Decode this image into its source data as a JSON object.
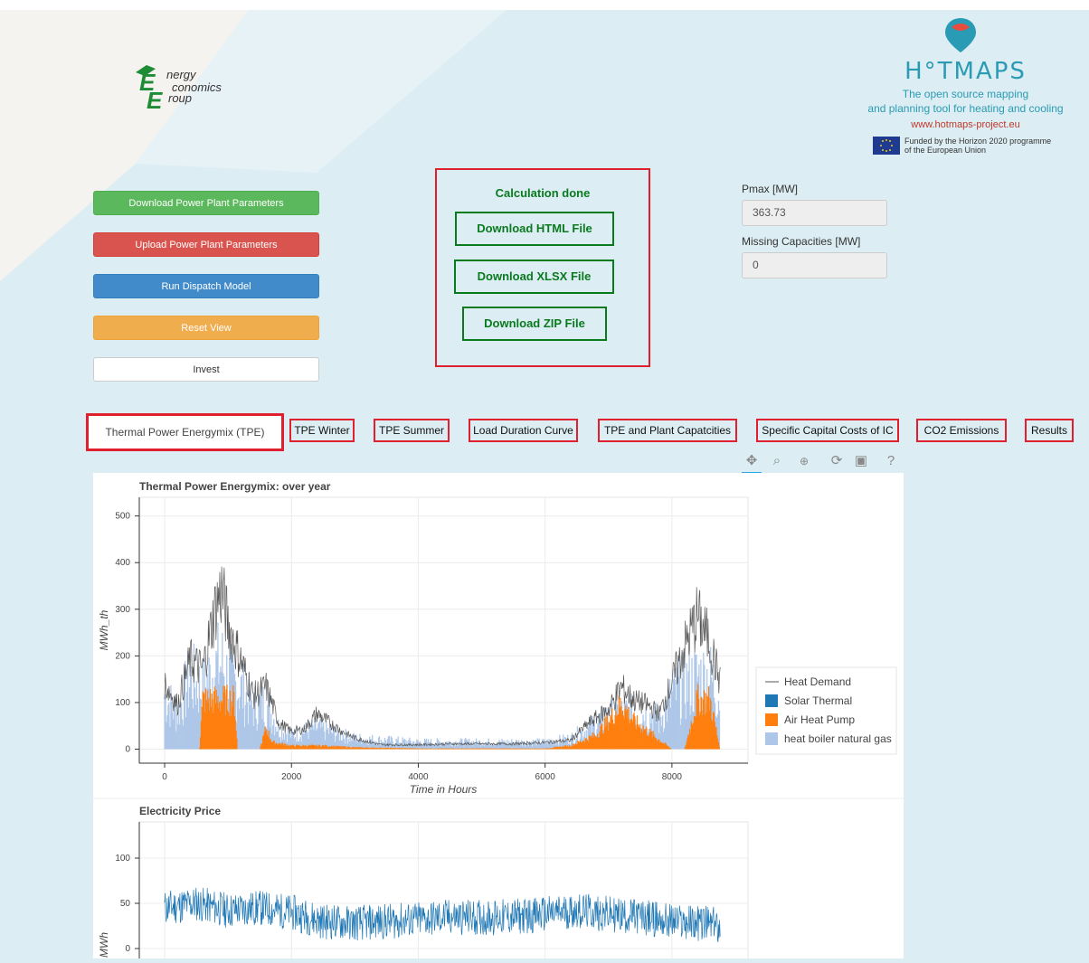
{
  "logos": {
    "eeg_lines": [
      "nergy",
      "conomics",
      "roup"
    ],
    "hotmaps_title": "H°TMAPS",
    "hotmaps_tagline_1": "The open source mapping",
    "hotmaps_tagline_2": "and planning tool for heating and cooling",
    "hotmaps_url": "www.hotmaps-project.eu",
    "eu_text_1": "Funded by the Horizon 2020 programme",
    "eu_text_2": "of the European Union"
  },
  "buttons": {
    "download_params": "Download Power Plant Parameters",
    "upload_params": "Upload Power Plant Parameters",
    "run_dispatch": "Run Dispatch Model",
    "reset_view": "Reset View",
    "invest": "Invest"
  },
  "calculation": {
    "status": "Calculation done",
    "download_html": "Download HTML File",
    "download_xlsx": "Download XLSX File",
    "download_zip": "Download ZIP File"
  },
  "fields": {
    "pmax_label": "Pmax [MW]",
    "pmax_value": "363.73",
    "missing_label": "Missing Capacities [MW]",
    "missing_value": "0"
  },
  "tabs": [
    "Thermal Power Energymix (TPE)",
    "TPE Winter",
    "TPE Summer",
    "Load Duration Curve",
    "TPE and Plant Capatcities",
    "Specific Capital Costs of IC",
    "CO2 Emissions",
    "Results"
  ],
  "toolbar_icons": [
    "pan-icon",
    "box-zoom-icon",
    "wheel-zoom-icon",
    "reset-icon",
    "save-icon",
    "help-icon"
  ],
  "chart_data": [
    {
      "type": "area",
      "title": "Thermal Power Energymix: over year",
      "xlabel": "Time in Hours",
      "ylabel": "MWh_th",
      "xlim": [
        -400,
        9200
      ],
      "ylim": [
        -30,
        540
      ],
      "xticks": [
        0,
        2000,
        4000,
        6000,
        8000
      ],
      "yticks": [
        0,
        100,
        200,
        300,
        400,
        500
      ],
      "legend_position": "right",
      "series": [
        {
          "name": "Heat Demand",
          "kind": "line",
          "color": "#555555",
          "x": [
            0,
            200,
            400,
            600,
            800,
            900,
            1000,
            1200,
            1400,
            1600,
            1800,
            2000,
            2200,
            2400,
            2600,
            2800,
            3000,
            3400,
            4000,
            4500,
            5000,
            5500,
            6000,
            6400,
            6700,
            7000,
            7200,
            7400,
            7600,
            7800,
            8000,
            8200,
            8400,
            8600,
            8760
          ],
          "values": [
            150,
            100,
            200,
            180,
            320,
            360,
            280,
            200,
            120,
            140,
            60,
            40,
            45,
            80,
            60,
            40,
            25,
            10,
            10,
            12,
            12,
            12,
            15,
            20,
            60,
            90,
            140,
            110,
            100,
            80,
            150,
            230,
            300,
            240,
            150
          ]
        },
        {
          "name": "Solar Thermal",
          "kind": "area",
          "color": "#1f77b4",
          "values": []
        },
        {
          "name": "Air Heat Pump",
          "kind": "area",
          "color": "#ff7f0e",
          "x": [
            0,
            550,
            600,
            1100,
            1150,
            1500,
            1600,
            1700,
            2000,
            2500,
            3000,
            4000,
            5000,
            6000,
            6400,
            6800,
            7000,
            7200,
            7400,
            8000,
            8200,
            8400,
            8600,
            8760
          ],
          "values": [
            0,
            0,
            140,
            140,
            0,
            0,
            60,
            20,
            10,
            10,
            5,
            2,
            2,
            2,
            10,
            40,
            80,
            130,
            80,
            0,
            0,
            140,
            140,
            0
          ]
        },
        {
          "name": "heat boiler natural gas",
          "kind": "area",
          "color": "#aec7e8",
          "x": [
            0,
            200,
            400,
            600,
            800,
            900,
            1000,
            1200,
            1400,
            1600,
            1800,
            2000,
            2400,
            3000,
            4000,
            5000,
            6000,
            6400,
            6700,
            7000,
            7200,
            7400,
            7600,
            7800,
            8000,
            8200,
            8400,
            8600,
            8760
          ],
          "values": [
            150,
            100,
            200,
            170,
            230,
            240,
            200,
            170,
            120,
            130,
            60,
            40,
            60,
            30,
            20,
            20,
            20,
            30,
            60,
            90,
            100,
            100,
            100,
            80,
            150,
            180,
            200,
            200,
            150
          ]
        }
      ]
    },
    {
      "type": "line",
      "title": "Electricity Price",
      "ylabel": "MWh",
      "xlim": [
        -400,
        9200
      ],
      "ylim": [
        -30,
        140
      ],
      "yticks": [
        0,
        50,
        100
      ],
      "series": [
        {
          "name": "",
          "color": "#1f77b4",
          "x": [
            0,
            500,
            1000,
            1500,
            2000,
            2500,
            3000,
            3500,
            4000,
            4500,
            5000,
            5500,
            6000,
            6500,
            7000,
            7500,
            8000,
            8500,
            8760
          ],
          "values": [
            45,
            50,
            42,
            45,
            40,
            30,
            28,
            30,
            32,
            35,
            34,
            35,
            38,
            42,
            38,
            35,
            30,
            28,
            25
          ]
        }
      ]
    }
  ]
}
